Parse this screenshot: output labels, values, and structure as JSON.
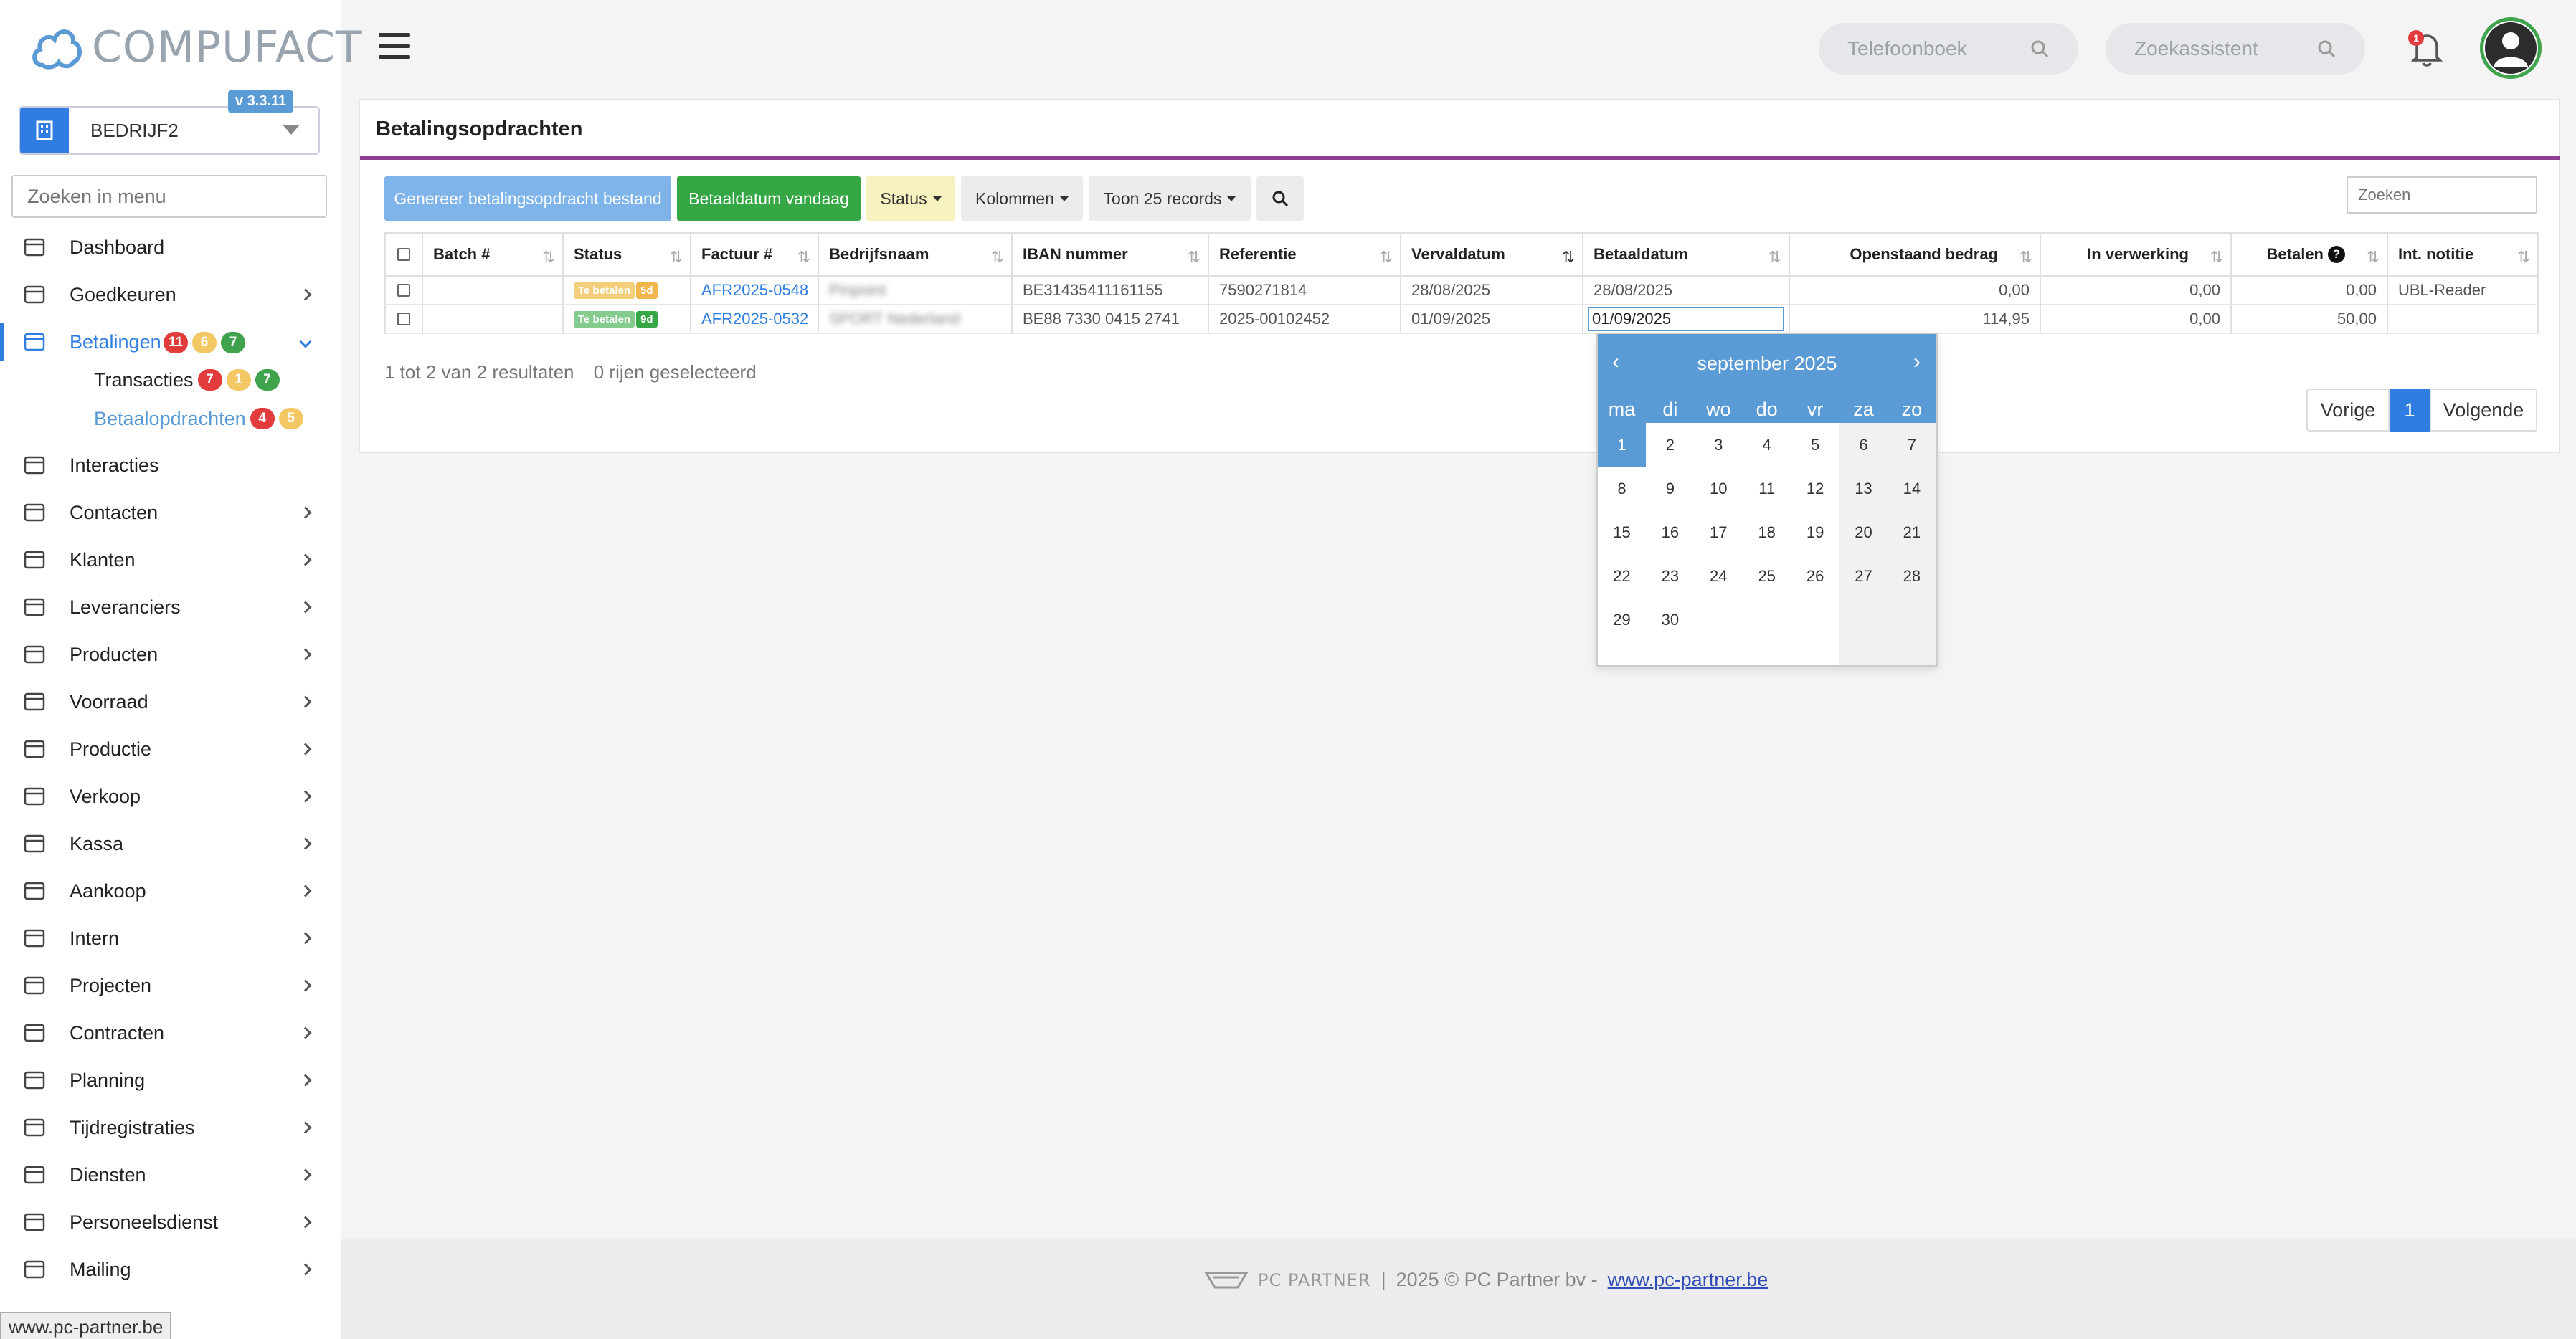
{
  "app": {
    "logo_text": "COMPUFACT",
    "version": "v 3.3.11",
    "company": "BEDRIJF2",
    "menu_search_placeholder": "Zoeken in menu"
  },
  "sidebar": {
    "items": [
      {
        "label": "Dashboard",
        "icon": "palette-icon"
      },
      {
        "label": "Goedkeuren",
        "icon": "user-check-icon"
      },
      {
        "label": "Betalingen",
        "icon": "credit-card-icon",
        "badges": [
          "11",
          "6",
          "7"
        ]
      },
      {
        "label": "Interacties",
        "icon": "chat-icon"
      },
      {
        "label": "Contacten",
        "icon": "contact-card-icon"
      },
      {
        "label": "Klanten",
        "icon": "customer-icon"
      },
      {
        "label": "Leveranciers",
        "icon": "truck-icon"
      },
      {
        "label": "Producten",
        "icon": "box-icon"
      },
      {
        "label": "Voorraad",
        "icon": "boxes-icon"
      },
      {
        "label": "Productie",
        "icon": "gears-icon"
      },
      {
        "label": "Verkoop",
        "icon": "euro-icon"
      },
      {
        "label": "Kassa",
        "icon": "basket-icon"
      },
      {
        "label": "Aankoop",
        "icon": "cart-icon"
      },
      {
        "label": "Intern",
        "icon": "team-icon"
      },
      {
        "label": "Projecten",
        "icon": "project-icon"
      },
      {
        "label": "Contracten",
        "icon": "contract-icon"
      },
      {
        "label": "Planning",
        "icon": "calendar-icon"
      },
      {
        "label": "Tijdregistraties",
        "icon": "timer-icon"
      },
      {
        "label": "Diensten",
        "icon": "repeat-icon"
      },
      {
        "label": "Personeelsdienst",
        "icon": "staff-icon"
      },
      {
        "label": "Mailing",
        "icon": "paper-plane-icon"
      }
    ],
    "sub_items": [
      {
        "label": "Transacties",
        "badges": [
          "7",
          "1",
          "7"
        ]
      },
      {
        "label": "Betaalopdrachten",
        "badges": [
          "4",
          "5"
        ]
      }
    ]
  },
  "topbar": {
    "phonebook_placeholder": "Telefoonboek",
    "assistant_placeholder": "Zoekassistent",
    "notification_count": "1"
  },
  "page": {
    "title": "Betalingsopdrachten",
    "buttons": {
      "generate": "Genereer betalingsopdracht bestand",
      "pay_today": "Betaaldatum vandaag",
      "status": "Status",
      "columns": "Kolommen",
      "show_records": "Toon 25 records"
    },
    "search_placeholder": "Zoeken"
  },
  "table": {
    "columns": [
      "Batch #",
      "Status",
      "Factuur #",
      "Bedrijfsnaam",
      "IBAN nummer",
      "Referentie",
      "Vervaldatum",
      "Betaaldatum",
      "Openstaand bedrag",
      "In verwerking",
      "Betalen",
      "Int. notitie"
    ],
    "rows": [
      {
        "batch": "",
        "status_label": "Te betalen",
        "status_days": "5d",
        "invoice": "AFR2025-0548",
        "company": "Pinpoint",
        "iban": "BE31435411161155",
        "reference": "7590271814",
        "due_date": "28/08/2025",
        "pay_date": "28/08/2025",
        "outstanding": "0,00",
        "processing": "0,00",
        "pay": "0,00",
        "note": "UBL-Reader"
      },
      {
        "batch": "",
        "status_label": "Te betalen",
        "status_days": "9d",
        "invoice": "AFR2025-0532",
        "company": "SPORT Nederland",
        "iban": "BE88 7330 0415 2741",
        "reference": "2025-00102452",
        "due_date": "01/09/2025",
        "pay_date": "01/09/2025",
        "outstanding": "114,95",
        "processing": "0,00",
        "pay": "50,00",
        "note": ""
      }
    ]
  },
  "summary": {
    "results": "1 tot 2 van 2 resultaten",
    "selected": "0 rijen geselecteerd"
  },
  "pagination": {
    "prev": "Vorige",
    "current": "1",
    "next": "Volgende"
  },
  "datepicker": {
    "month": "september 2025",
    "weekdays": [
      "ma",
      "di",
      "wo",
      "do",
      "vr",
      "za",
      "zo"
    ],
    "days": [
      "1",
      "2",
      "3",
      "4",
      "5",
      "6",
      "7",
      "8",
      "9",
      "10",
      "11",
      "12",
      "13",
      "14",
      "15",
      "16",
      "17",
      "18",
      "19",
      "20",
      "21",
      "22",
      "23",
      "24",
      "25",
      "26",
      "27",
      "28",
      "29",
      "30"
    ],
    "selected_day": "1"
  },
  "footer": {
    "brand": "PC PARTNER",
    "separator": "|",
    "copyright": "2025 © PC Partner bv -",
    "link": "www.pc-partner.be"
  },
  "statusbar": {
    "url": "www.pc-partner.be"
  },
  "colors": {
    "primary": "#2f7de1",
    "accent_rule": "#8a3f8f",
    "success": "#36a745"
  }
}
